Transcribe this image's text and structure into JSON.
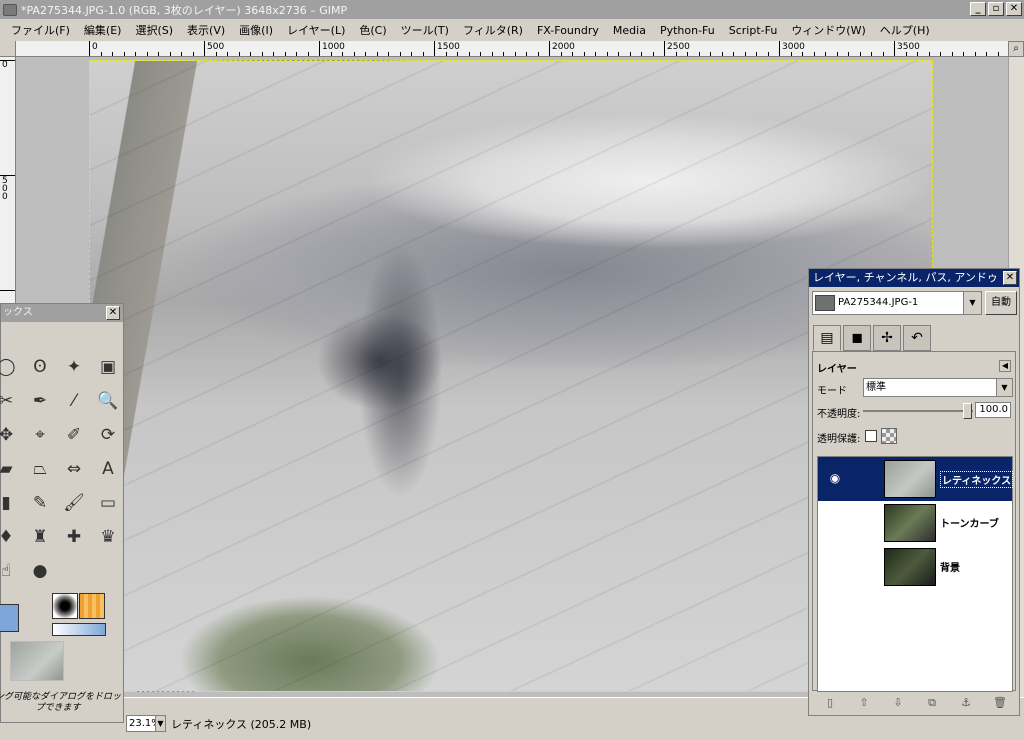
{
  "window": {
    "title": "*PA275344.JPG-1.0 (RGB, 3枚のレイヤー) 3648x2736 – GIMP",
    "minimize": "_",
    "maximize": "▫",
    "close": "✕"
  },
  "menu": [
    "ファイル(F)",
    "編集(E)",
    "選択(S)",
    "表示(V)",
    "画像(I)",
    "レイヤー(L)",
    "色(C)",
    "ツール(T)",
    "フィルタ(R)",
    "FX-Foundry",
    "Media",
    "Python-Fu",
    "Script-Fu",
    "ウィンドウ(W)",
    "ヘルプ(H)"
  ],
  "ruler": {
    "top_labels": [
      "0",
      "500",
      "1000",
      "1500",
      "2000",
      "2500",
      "3000",
      "3500"
    ],
    "left_labels": [
      "0",
      "500"
    ]
  },
  "status": {
    "zoom": "23.1%",
    "layer_info": "レティネックス (205.2 MB)"
  },
  "toolbox": {
    "title": "ックス",
    "close": "✕",
    "drop_hint": "ング可能なダイアログをドロップできます",
    "tools": [
      {
        "icon": "ellipse-select-icon",
        "glyph": "◯"
      },
      {
        "icon": "lasso-icon",
        "glyph": "ʘ"
      },
      {
        "icon": "magic-wand-icon",
        "glyph": "✦"
      },
      {
        "icon": "color-select-icon",
        "glyph": "▣"
      },
      {
        "icon": "scissors-icon",
        "glyph": "✂"
      },
      {
        "icon": "paths-icon",
        "glyph": "✒"
      },
      {
        "icon": "color-picker-icon",
        "glyph": "⁄"
      },
      {
        "icon": "zoom-icon",
        "glyph": "🔍"
      },
      {
        "icon": "move-icon",
        "glyph": "✥"
      },
      {
        "icon": "align-icon",
        "glyph": "⌖"
      },
      {
        "icon": "crop-icon",
        "glyph": "✐"
      },
      {
        "icon": "rotate-icon",
        "glyph": "⟳"
      },
      {
        "icon": "scale-icon",
        "glyph": "▰"
      },
      {
        "icon": "perspective-icon",
        "glyph": "⏢"
      },
      {
        "icon": "flip-icon",
        "glyph": "⇔"
      },
      {
        "icon": "text-icon",
        "glyph": "A"
      },
      {
        "icon": "bucket-icon",
        "glyph": "▮"
      },
      {
        "icon": "pencil-icon",
        "glyph": "✎"
      },
      {
        "icon": "paintbrush-icon",
        "glyph": "🖌"
      },
      {
        "icon": "eraser-icon",
        "glyph": "▭"
      },
      {
        "icon": "airbrush-icon",
        "glyph": "♦"
      },
      {
        "icon": "clone-icon",
        "glyph": "♜"
      },
      {
        "icon": "heal-icon",
        "glyph": "✚"
      },
      {
        "icon": "perspective-clone-icon",
        "glyph": "♛"
      },
      {
        "icon": "smudge-icon",
        "glyph": "☝"
      },
      {
        "icon": "dodge-burn-icon",
        "glyph": "●"
      }
    ]
  },
  "dock": {
    "title": "レイヤー, チャンネル, パス, アンドゥ",
    "close": "✕",
    "image_select": "PA275344.JPG-1",
    "auto_button": "自動",
    "tabs": [
      {
        "icon": "layers-tab-icon",
        "glyph": "▤"
      },
      {
        "icon": "channels-tab-icon",
        "glyph": "◼"
      },
      {
        "icon": "paths-tab-icon",
        "glyph": "✢"
      },
      {
        "icon": "undo-tab-icon",
        "glyph": "↶"
      }
    ],
    "pane_title": "レイヤー",
    "mode_label": "モード",
    "mode_value": "標準",
    "opacity_label": "不透明度:",
    "opacity_value": "100.0",
    "opacity": 1.0,
    "lock_label": "透明保護:",
    "layers": [
      {
        "name": "レティネックス",
        "visible": true,
        "selected": true
      },
      {
        "name": "トーンカーブ",
        "visible": false,
        "selected": false
      },
      {
        "name": "背景",
        "visible": false,
        "selected": false
      }
    ],
    "buttons": [
      {
        "icon": "new-layer-icon",
        "glyph": "▯"
      },
      {
        "icon": "raise-layer-icon",
        "glyph": "⇧"
      },
      {
        "icon": "lower-layer-icon",
        "glyph": "⇩"
      },
      {
        "icon": "duplicate-layer-icon",
        "glyph": "⧉"
      },
      {
        "icon": "anchor-layer-icon",
        "glyph": "⚓"
      },
      {
        "icon": "delete-layer-icon",
        "glyph": "🗑"
      }
    ]
  }
}
